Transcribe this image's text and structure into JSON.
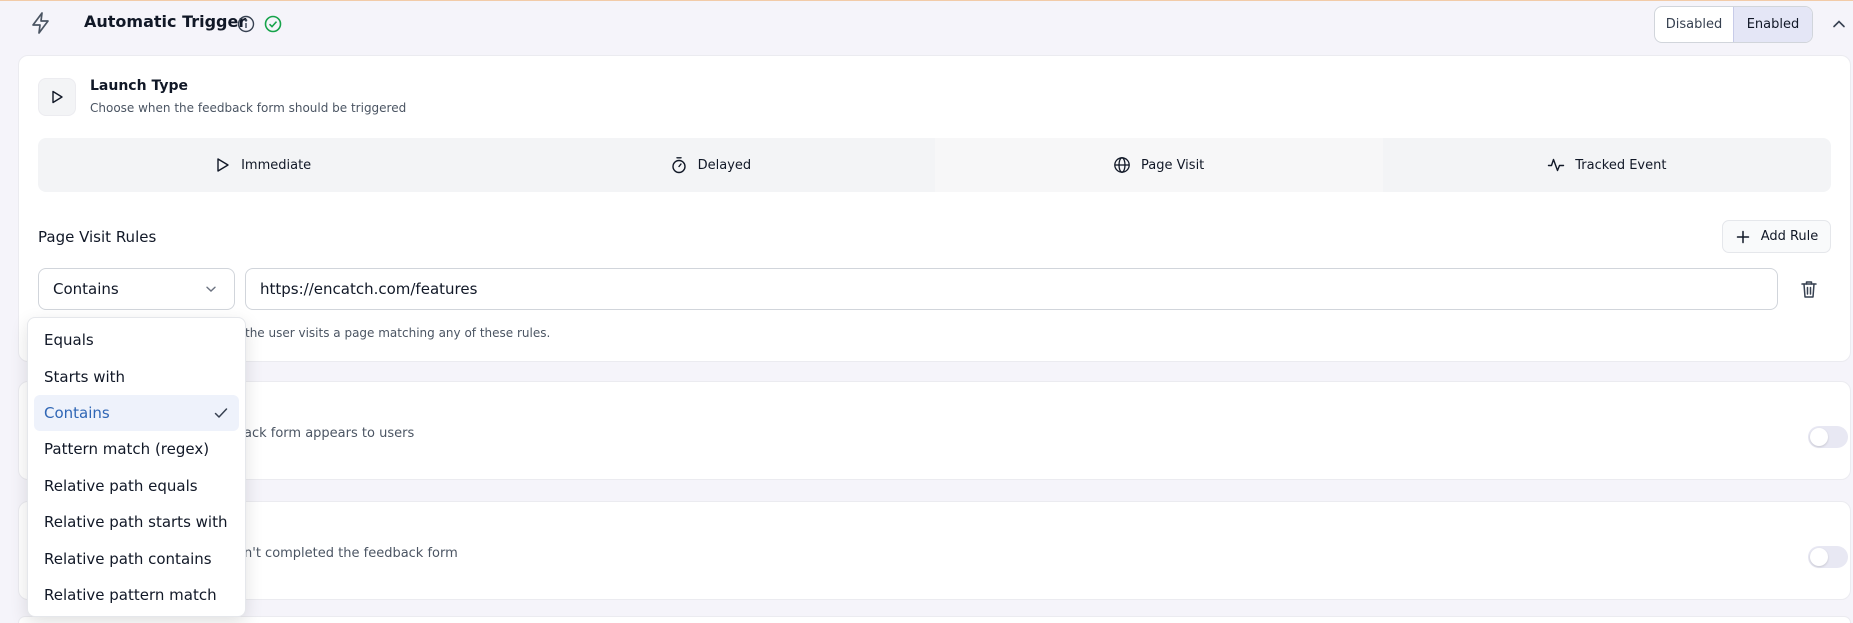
{
  "header": {
    "title": "Automatic Trigger",
    "segment": {
      "disabled_label": "Disabled",
      "enabled_label": "Enabled",
      "selected": "Enabled"
    }
  },
  "launch_type": {
    "title": "Launch Type",
    "subtitle": "Choose when the feedback form should be triggered",
    "tabs": [
      {
        "label": "Immediate",
        "icon": "play-icon"
      },
      {
        "label": "Delayed",
        "icon": "stopwatch-icon"
      },
      {
        "label": "Page Visit",
        "icon": "globe-icon"
      },
      {
        "label": "Tracked Event",
        "icon": "activity-icon"
      }
    ],
    "active_tab": "Page Visit"
  },
  "page_visit_rules": {
    "title": "Page Visit Rules",
    "add_rule_label": "Add Rule",
    "rule": {
      "operator": "Contains",
      "url": "https://encatch.com/features"
    },
    "helper_text": "the user visits a page matching any of these rules."
  },
  "dropdown": {
    "options": [
      "Equals",
      "Starts with",
      "Contains",
      "Pattern match (regex)",
      "Relative path equals",
      "Relative path starts with",
      "Relative path contains",
      "Relative pattern match"
    ],
    "selected": "Contains"
  },
  "cards": [
    {
      "subtitle": "ack form appears to users",
      "toggle_on": false
    },
    {
      "subtitle": "n't completed the feedback form",
      "toggle_on": false
    }
  ],
  "colors": {
    "accent": "#2f66b5",
    "selected_bg": "#eef2fb",
    "success": "#16a34a",
    "segment_active": "#e4e6f6"
  }
}
